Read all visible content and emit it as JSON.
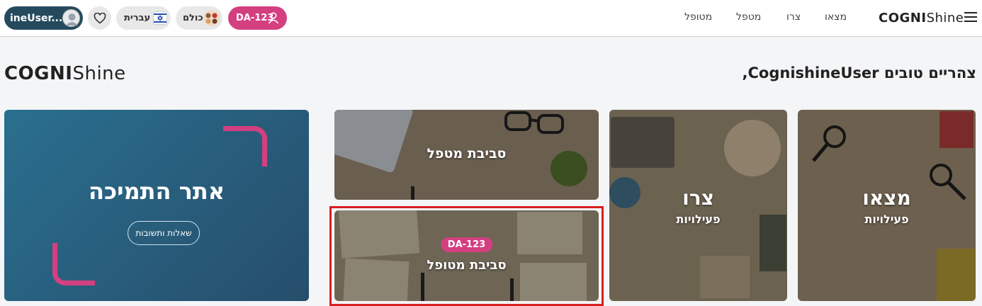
{
  "header": {
    "user_label": "ineUser...",
    "language_label": "עברית",
    "all_label": "כולם",
    "code_label": "DA-123",
    "nav": [
      "מצאו",
      "צרו",
      "מטפל",
      "מטופל"
    ],
    "brand_cogni": "COGNI",
    "brand_shine": "Shine"
  },
  "main": {
    "greeting": "צהריים טובים CognishineUser,",
    "brand_cogni": "COGNI",
    "brand_shine": "Shine"
  },
  "tiles": [
    {
      "title": "מצאו",
      "subtitle": "פעילויות"
    },
    {
      "title": "צרו",
      "subtitle": "פעילויות"
    },
    {
      "title": "סביבת מטפל"
    },
    {
      "title": "סביבת מטופל",
      "badge": "DA-123"
    }
  ],
  "support": {
    "title": "אתר התמיכה",
    "faq_label": "שאלות ותשובות"
  },
  "colors": {
    "accent_pink": "#d43f80",
    "dark_teal": "#254a5d",
    "highlight_red": "#d81e1e"
  }
}
